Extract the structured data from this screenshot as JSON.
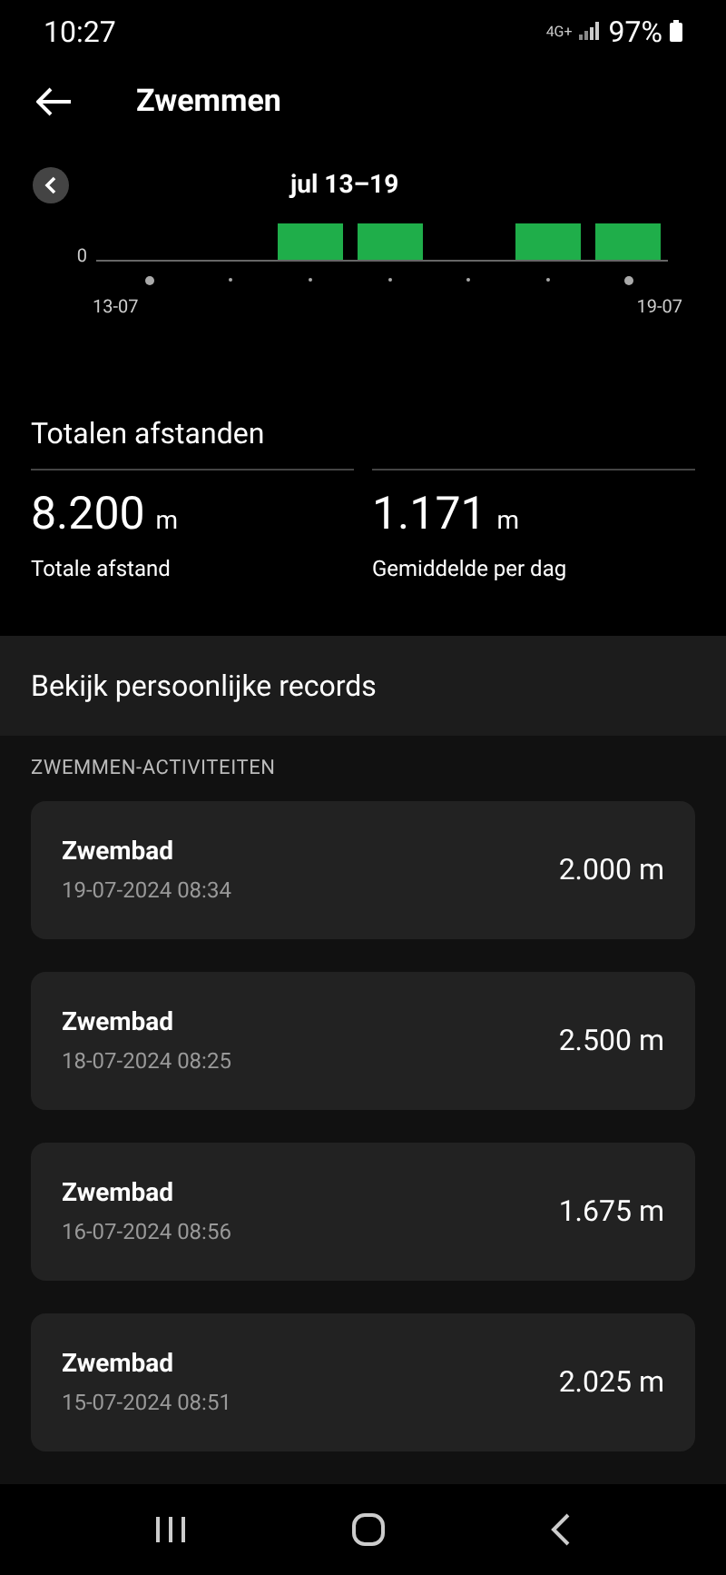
{
  "status_bar": {
    "time": "10:27",
    "network": "4G+",
    "battery": "97%"
  },
  "header": {
    "title": "Zwemmen"
  },
  "chart": {
    "period": "jul 13–19",
    "y_tick": "0",
    "start_label": "13-07",
    "end_label": "19-07",
    "days": [
      {
        "active": false,
        "today": true
      },
      {
        "active": false,
        "today": false
      },
      {
        "active": true,
        "today": false
      },
      {
        "active": true,
        "today": false
      },
      {
        "active": false,
        "today": false
      },
      {
        "active": true,
        "today": false
      },
      {
        "active": true,
        "today": true
      }
    ]
  },
  "totals": {
    "title": "Totalen afstanden",
    "stats": [
      {
        "value": "8.200",
        "unit": "m",
        "label": "Totale afstand"
      },
      {
        "value": "1.171",
        "unit": "m",
        "label": "Gemiddelde per dag"
      }
    ]
  },
  "records_link": "Bekijk persoonlijke records",
  "activities_heading": "ZWEMMEN-ACTIVITEITEN",
  "activities": [
    {
      "name": "Zwembad",
      "datetime": "19-07-2024 08:34",
      "distance": "2.000 m"
    },
    {
      "name": "Zwembad",
      "datetime": "18-07-2024 08:25",
      "distance": "2.500 m"
    },
    {
      "name": "Zwembad",
      "datetime": "16-07-2024 08:56",
      "distance": "1.675 m"
    },
    {
      "name": "Zwembad",
      "datetime": "15-07-2024 08:51",
      "distance": "2.025 m"
    }
  ]
}
